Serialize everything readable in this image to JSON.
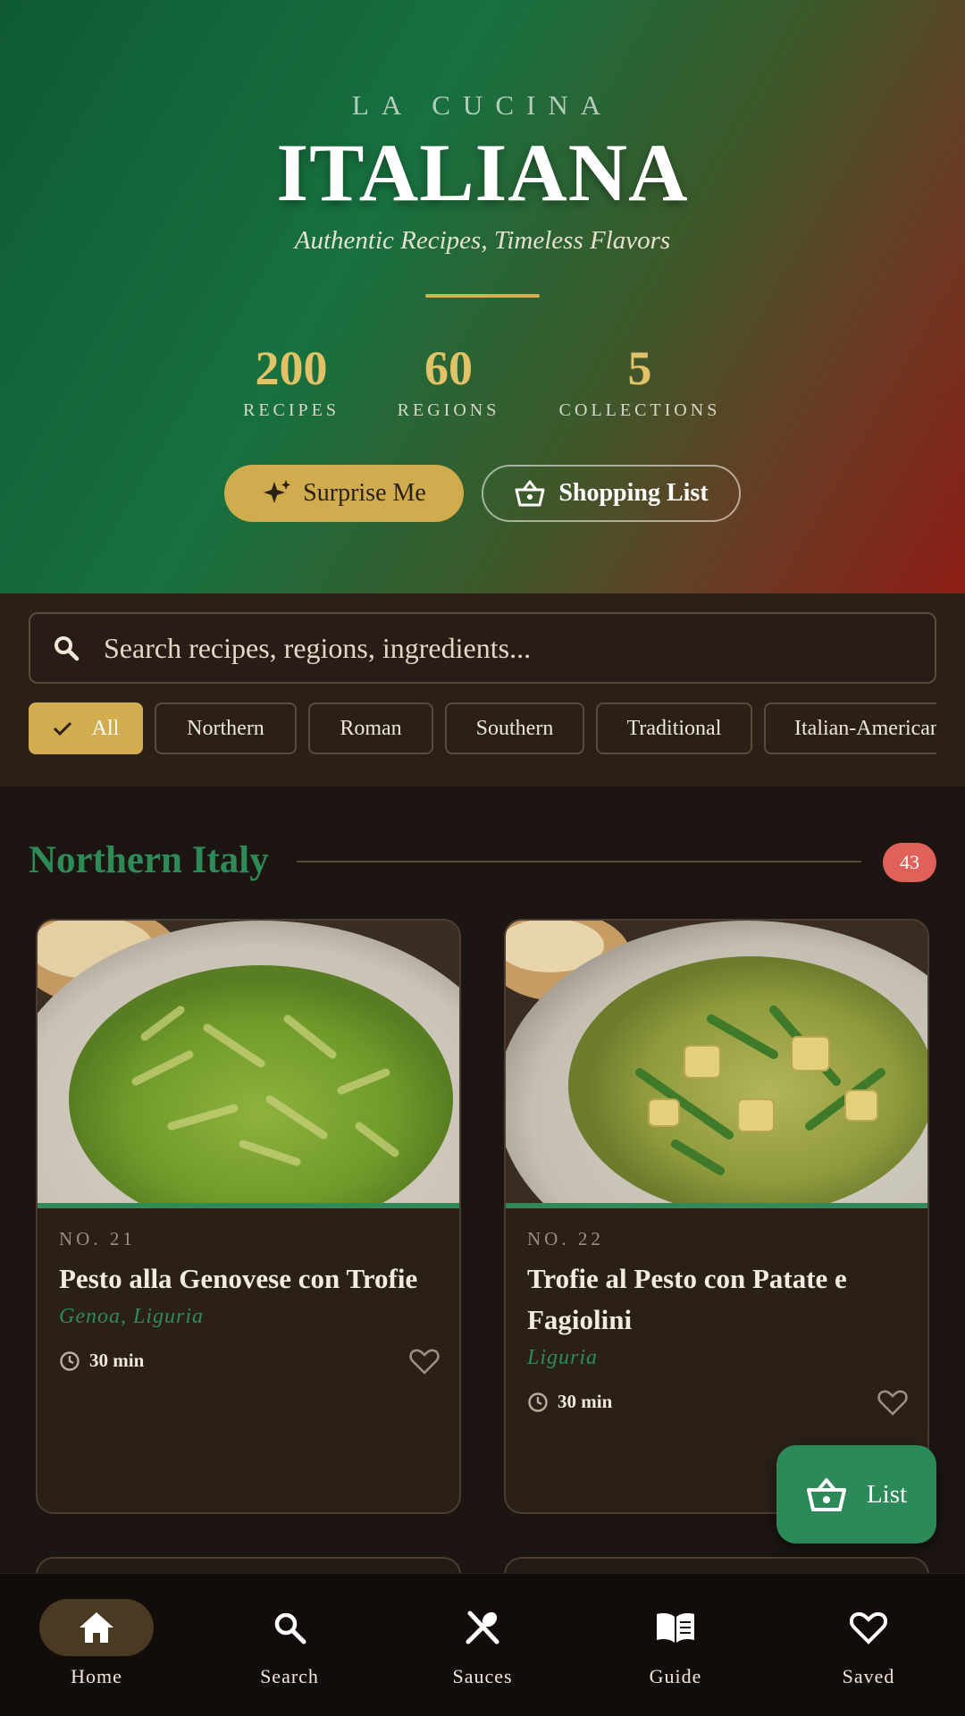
{
  "hero": {
    "kicker": "LA CUCINA",
    "title": "ITALIANA",
    "subtitle": "Authentic Recipes, Timeless Flavors",
    "stats": [
      {
        "value": "200",
        "label": "RECIPES"
      },
      {
        "value": "60",
        "label": "REGIONS"
      },
      {
        "value": "5",
        "label": "COLLECTIONS"
      }
    ],
    "surprise_label": "Surprise Me",
    "shopping_label": "Shopping List"
  },
  "search": {
    "placeholder": "Search recipes, regions, ingredients..."
  },
  "filters": [
    "All",
    "Northern",
    "Roman",
    "Southern",
    "Traditional",
    "Italian-American"
  ],
  "active_filter": "All",
  "section": {
    "title": "Northern Italy",
    "count": "43"
  },
  "recipes": [
    {
      "number": "NO. 21",
      "name": "Pesto alla Genovese con Trofie",
      "region": "Genoa, Liguria",
      "time": "30 min"
    },
    {
      "number": "NO. 22",
      "name": "Trofie al Pesto con Patate e Fagiolini",
      "region": "Liguria",
      "time": "30 min"
    }
  ],
  "fab": {
    "label": "List"
  },
  "nav": [
    {
      "label": "Home",
      "icon": "home-icon"
    },
    {
      "label": "Search",
      "icon": "search-icon"
    },
    {
      "label": "Sauces",
      "icon": "utensils-icon"
    },
    {
      "label": "Guide",
      "icon": "book-icon"
    },
    {
      "label": "Saved",
      "icon": "heart-icon"
    }
  ],
  "colors": {
    "accent_gold": "#d1ad4f",
    "accent_green": "#2e8b57",
    "badge_red": "#e0615a",
    "background": "#1c1511"
  }
}
